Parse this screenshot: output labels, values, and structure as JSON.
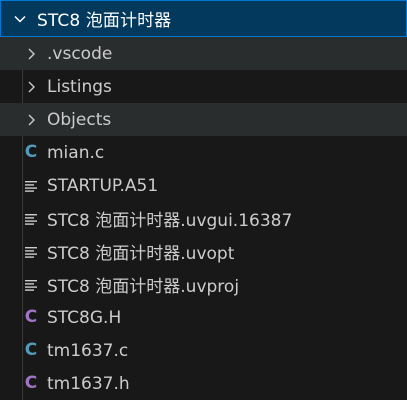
{
  "folder": {
    "name": "STC8 泡面计时器",
    "expanded": true,
    "chevron_icon": "chevron-down-icon"
  },
  "items": [
    {
      "label": ".vscode",
      "kind": "folder",
      "icon": "chevron-right-icon",
      "icon_color": "#cccccc"
    },
    {
      "label": "Listings",
      "kind": "folder",
      "icon": "chevron-right-icon",
      "icon_color": "#cccccc"
    },
    {
      "label": "Objects",
      "kind": "folder",
      "icon": "chevron-right-icon",
      "icon_color": "#cccccc"
    },
    {
      "label": "mian.c",
      "kind": "file",
      "icon": "c-file-icon",
      "icon_glyph": "C",
      "icon_color": "#519aba"
    },
    {
      "label": "STARTUP.A51",
      "kind": "file",
      "icon": "text-lines-icon",
      "icon_color": "#cccccc"
    },
    {
      "label": "STC8 泡面计时器.uvgui.16387",
      "kind": "file",
      "icon": "text-lines-icon",
      "icon_color": "#cccccc"
    },
    {
      "label": "STC8 泡面计时器.uvopt",
      "kind": "file",
      "icon": "text-lines-icon",
      "icon_color": "#cccccc"
    },
    {
      "label": "STC8 泡面计时器.uvproj",
      "kind": "file",
      "icon": "text-lines-icon",
      "icon_color": "#cccccc"
    },
    {
      "label": "STC8G.H",
      "kind": "file",
      "icon": "c-header-icon",
      "icon_glyph": "C",
      "icon_color": "#a074c4"
    },
    {
      "label": "tm1637.c",
      "kind": "file",
      "icon": "c-file-icon",
      "icon_glyph": "C",
      "icon_color": "#519aba"
    },
    {
      "label": "tm1637.h",
      "kind": "file",
      "icon": "c-header-icon",
      "icon_glyph": "C",
      "icon_color": "#a074c4"
    }
  ],
  "colors": {
    "background": "#181818",
    "selected_background": "#04395e",
    "selected_border": "#0078d4",
    "hover_background": "#2a2d2e",
    "text": "#cccccc"
  }
}
